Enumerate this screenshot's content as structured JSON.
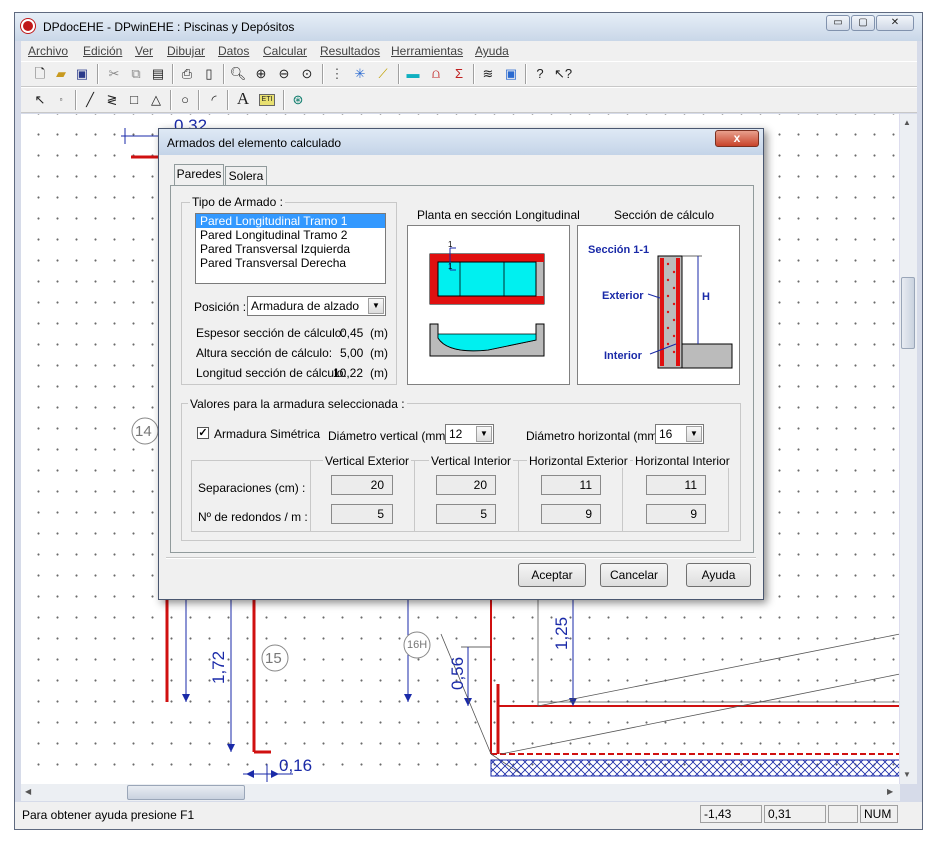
{
  "window": {
    "title": "DPdocEHE - DPwinEHE : Piscinas y Depósitos",
    "controls": [
      "▭",
      "▢",
      "✕"
    ]
  },
  "menu": [
    "Archivo",
    "Edición",
    "Ver",
    "Dibujar",
    "Datos",
    "Calcular",
    "Resultados",
    "Herramientas",
    "Ayuda"
  ],
  "canvas": {
    "dims": [
      "0,32",
      "1,72",
      "0,16",
      "0,56",
      "1,25"
    ],
    "labels": [
      "14",
      "15",
      "16H"
    ]
  },
  "statusbar": {
    "help": "Para obtener ayuda presione F1",
    "x": "-1,43",
    "y": "0,31",
    "num": "NUM"
  },
  "dialog": {
    "title": "Armados del elemento calculado",
    "close": "x",
    "tabs": [
      "Paredes",
      "Solera"
    ],
    "tipo_label": "Tipo de Armado :",
    "tipo_items": [
      "Pared Longitudinal Tramo 1",
      "Pared Longitudinal Tramo 2",
      "Pared Transversal Izquierda",
      "Pared Transversal Derecha"
    ],
    "posicion_label": "Posición :",
    "posicion_value": "Armadura de alzado",
    "espesor_label": "Espesor sección de cálculo:",
    "espesor_value": "0,45",
    "altura_label": "Altura sección de cálculo:",
    "altura_value": "5,00",
    "longitud_label": "Longitud sección de cálculo:",
    "longitud_value": "10,22",
    "unit": "(m)",
    "planta_title": "Planta en sección Longitudinal",
    "seccion_title": "Sección de cálculo",
    "seccion_label": "Sección 1-1",
    "exterior": "Exterior",
    "interior": "Interior",
    "h_label": "H",
    "one": "1",
    "valores_label": "Valores para la armadura seleccionada :",
    "simetrica_label": "Armadura Simétrica",
    "diam_v_label": "Diámetro vertical (mm) :",
    "diam_v_value": "12",
    "diam_h_label": "Diámetro horizontal (mm) :",
    "diam_h_value": "16",
    "col_headers": [
      "Vertical Exterior",
      "Vertical Interior",
      "Horizontal Exterior",
      "Horizontal Interior"
    ],
    "row_sep_label": "Separaciones (cm) :",
    "row_num_label": "Nº de redondos / m :",
    "separaciones": [
      "20",
      "20",
      "11",
      "11"
    ],
    "redondos": [
      "5",
      "5",
      "9",
      "9"
    ],
    "buttons": {
      "ok": "Aceptar",
      "cancel": "Cancelar",
      "help": "Ayuda"
    }
  }
}
